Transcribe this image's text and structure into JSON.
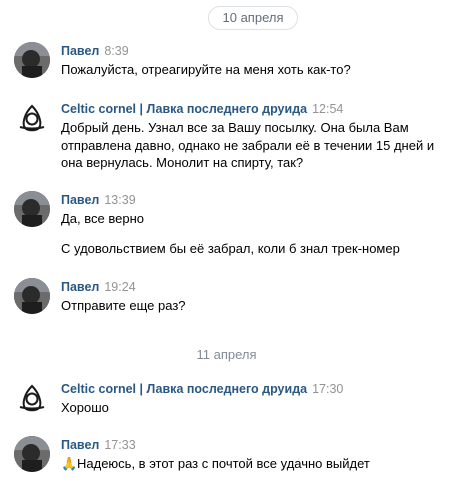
{
  "dates": {
    "first": "10 апреля",
    "second": "11 апреля"
  },
  "messages": [
    {
      "author": "Павел",
      "time": "8:39",
      "text": "Пожалуйста, отреагируйте на меня хоть как-то?"
    },
    {
      "author": "Celtic cornel | Лавка последнего друида",
      "time": "12:54",
      "text": "Добрый день. Узнал все за Вашу посылку. Она была Вам отправлена давно, однако не забрали её в течении 15 дней и она вернулась. Монолит на спирту, так?"
    },
    {
      "author": "Павел",
      "time": "13:39",
      "text": "Да, все верно",
      "text2": "С удовольствием бы её забрал, коли б знал трек-номер"
    },
    {
      "author": "Павел",
      "time": "19:24",
      "text": "Отправите еще раз?"
    },
    {
      "author": "Celtic cornel | Лавка последнего друида",
      "time": "17:30",
      "text": "Хорошо"
    },
    {
      "author": "Павел",
      "time": "17:33",
      "emoji": "🙏",
      "text": "Надеюсь, в этот раз с почтой все удачно выйдет"
    }
  ],
  "icons": {
    "user_avatar": "user-photo-avatar",
    "shop_avatar": "celtic-triquetra-logo"
  },
  "colors": {
    "author": "#2a5885",
    "time": "#939393",
    "date": "#828a99"
  }
}
